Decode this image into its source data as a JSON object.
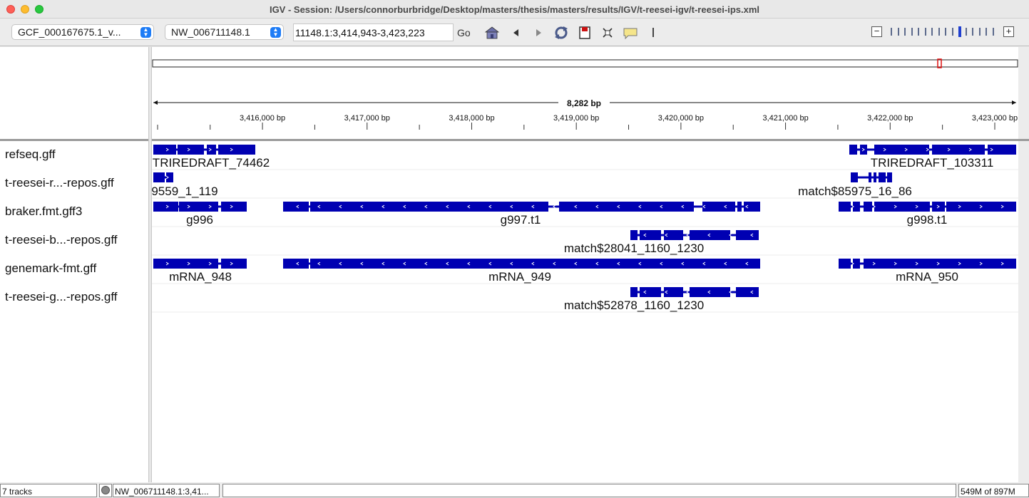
{
  "window": {
    "title": "IGV - Session: /Users/connorburbridge/Desktop/masters/thesis/masters/results/IGV/t-reesei-igv/t-reesei-ips.xml"
  },
  "toolbar": {
    "genome_select": "GCF_000167675.1_v...",
    "chromosome_select": "NW_006711148.1",
    "locus_value": "11148.1:3,414,943-3,423,223",
    "go_label": "Go",
    "icons": [
      "home-icon",
      "back-arrow-icon",
      "forward-arrow-icon",
      "refresh-icon",
      "roi-icon",
      "fit-width-icon",
      "popup-text-icon",
      "ruler-marker-icon"
    ],
    "zoom_minus": "−",
    "zoom_plus": "+",
    "zoom_ticks": 16,
    "zoom_level_index": 10
  },
  "ruler": {
    "span_label": "8,282 bp",
    "region_start": 3414943,
    "region_end": 3423225,
    "tick_labels": [
      "3,416,000 bp",
      "3,417,000 bp",
      "3,418,000 bp",
      "3,419,000 bp",
      "3,420,000 bp",
      "3,421,000 bp",
      "3,422,000 bp",
      "3,423,000 bp"
    ],
    "tick_values": [
      3416000,
      3417000,
      3418000,
      3419000,
      3420000,
      3421000,
      3422000,
      3423000
    ]
  },
  "tracks": [
    {
      "name": "refseq.gff",
      "labels": [
        "TRIREDRAFT_74462",
        "TRIREDRAFT_103311"
      ]
    },
    {
      "name": "t-reesei-r...-repos.gff",
      "labels": [
        "9559_1_119",
        "match$85975_16_86"
      ]
    },
    {
      "name": "braker.fmt.gff3",
      "labels": [
        "g996",
        "g997.t1",
        "g998.t1"
      ]
    },
    {
      "name": "t-reesei-b...-repos.gff",
      "labels": [
        "match$28041_1160_1230"
      ]
    },
    {
      "name": "genemark-fmt.gff",
      "labels": [
        "mRNA_948",
        "mRNA_949",
        "mRNA_950"
      ]
    },
    {
      "name": "t-reesei-g...-repos.gff",
      "labels": [
        "match$52878_1160_1230"
      ]
    }
  ],
  "colors": {
    "feature": "#0000b2",
    "roi": "#e01010"
  },
  "status": {
    "tracks": "7 tracks",
    "locus": "NW_006711148.1:3,41...",
    "memory": "549M of 897M"
  }
}
